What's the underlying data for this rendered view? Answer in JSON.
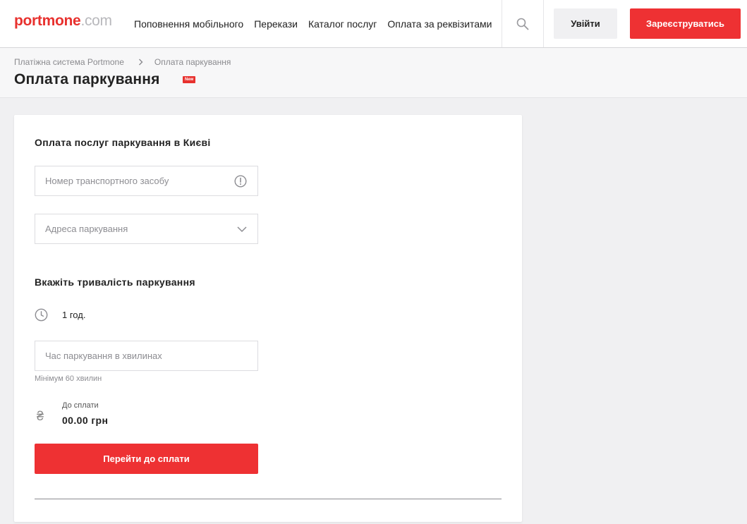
{
  "header": {
    "logo_brand": "portmone",
    "logo_tld": ".com",
    "nav": [
      {
        "label": "Поповнення мобільного"
      },
      {
        "label": "Перекази"
      },
      {
        "label": "Каталог послуг"
      },
      {
        "label": "Оплата за реквізитами"
      }
    ],
    "login_label": "Увійти",
    "register_label": "Зареєструватись"
  },
  "breadcrumb": {
    "items": [
      "Платіжна система Portmone",
      "Оплата паркування"
    ]
  },
  "page": {
    "title": "Оплата паркування",
    "badge": "New"
  },
  "form": {
    "section_title": "Оплата послуг паркування в Києві",
    "vehicle_placeholder": "Номер транспортного засобу",
    "vehicle_value": "",
    "address_placeholder": "Адреса паркування",
    "duration_title": "Вкажіть тривалість паркування",
    "duration_value": "1 год.",
    "minutes_placeholder": "Час паркування в хвилинах",
    "minutes_value": "",
    "minutes_hint": "Мінімум 60 хвилин",
    "currency_symbol": "₴",
    "to_pay_label": "До сплати",
    "to_pay_amount": "00.00 грн",
    "submit_label": "Перейти до сплати"
  },
  "colors": {
    "accent": "#ee3133",
    "background": "#f0f0f2"
  }
}
